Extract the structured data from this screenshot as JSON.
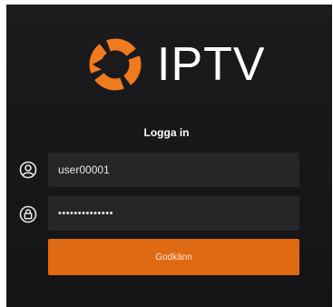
{
  "brand": {
    "name": "IPTV",
    "icon": "iptv-ring-logo",
    "accent_color": "#e06a14"
  },
  "login": {
    "title": "Logga in",
    "username": {
      "value": "user00001",
      "icon": "user-icon"
    },
    "password": {
      "value": "••••••••••••••",
      "icon": "lock-icon"
    },
    "submit_label": "Godkänn"
  }
}
